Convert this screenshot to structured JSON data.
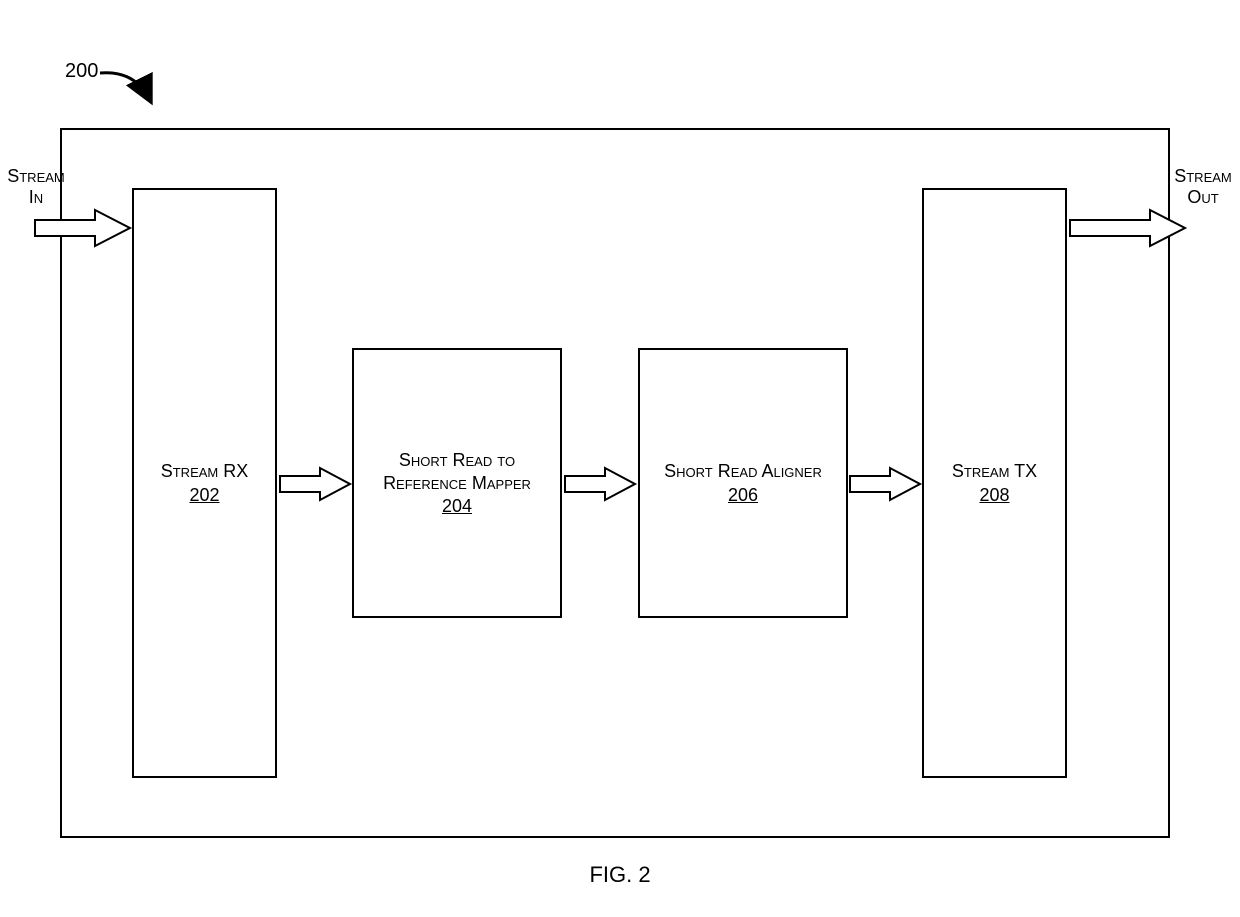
{
  "figure_ref": "200",
  "labels": {
    "stream_in": "Stream\nIn",
    "stream_out": "Stream\nOut"
  },
  "blocks": {
    "stream_rx": {
      "title": "Stream RX",
      "ref": "202"
    },
    "mapper": {
      "title": "Short Read to\nReference Mapper",
      "ref": "204"
    },
    "aligner": {
      "title": "Short Read Aligner",
      "ref": "206"
    },
    "stream_tx": {
      "title": "Stream TX",
      "ref": "208"
    }
  },
  "caption": "FIG. 2"
}
